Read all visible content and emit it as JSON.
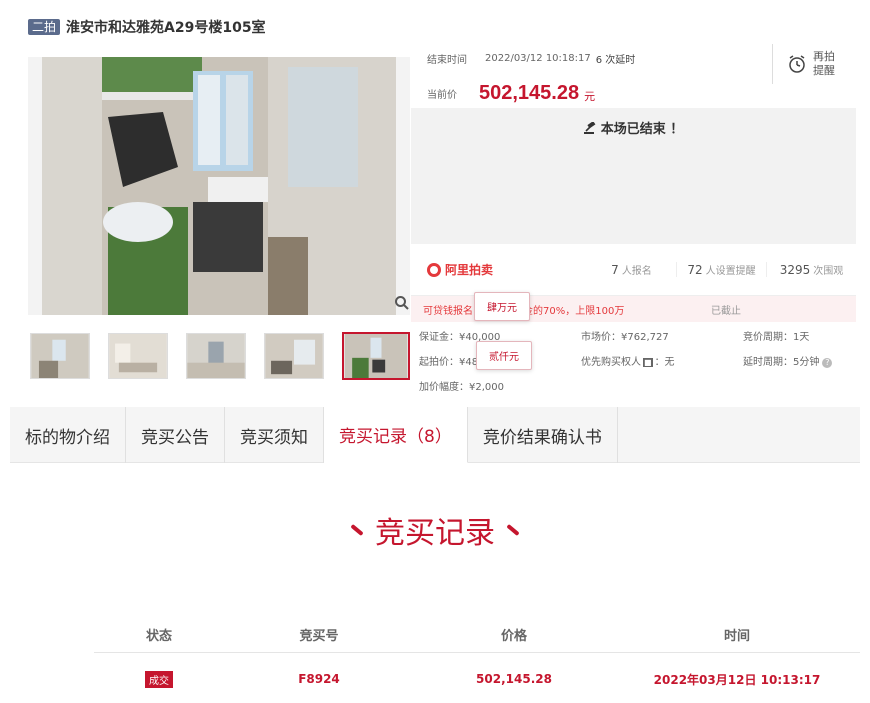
{
  "header": {
    "round_badge": "二拍",
    "lot_title": "淮安市和达雅苑A29号楼105室"
  },
  "auction": {
    "end_label": "结束时间",
    "end_time": "2022/03/12 10:18:17",
    "delay_text": "6 次延时",
    "remind_label": "再拍提醒",
    "price_label": "当前价",
    "current_price": "502,145.28",
    "price_unit": "元",
    "ended_text": "本场已结束 ！"
  },
  "stats": {
    "logo_text": "阿里拍卖",
    "signup_count": "7",
    "signup_label": "人报名",
    "remind_count": "72",
    "remind_label": "人设置提醒",
    "view_count": "3295",
    "view_label": "次围观"
  },
  "loan": {
    "text": "可贷钱报名，最高保证金的70%，上限100万",
    "end": "已截止"
  },
  "details": {
    "deposit": "保证金：¥40,000",
    "market_price": "市场价：¥762,727",
    "bid_cycle": "竞价周期：1天",
    "start_price": "起拍价：¥480,000",
    "priority": "优先购买权人",
    "priority_val": "：无",
    "delay_cycle": "延时周期：5分钟",
    "increment": "加价幅度：¥2,000"
  },
  "tooltips": {
    "tip1": "肆万元",
    "tip2": "贰仟元"
  },
  "tabs": [
    {
      "label": "标的物介绍"
    },
    {
      "label": "竞买公告"
    },
    {
      "label": "竞买须知"
    },
    {
      "label": "竞买记录（8）"
    },
    {
      "label": "竞价结果确认书"
    }
  ],
  "records": {
    "section_title": "竞买记录",
    "headers": {
      "status": "状态",
      "bid_no": "竞买号",
      "price": "价格",
      "time": "时间"
    },
    "rows": [
      {
        "status": "成交",
        "bid_no": "F8924",
        "price": "502,145.28",
        "time": "2022年03月12日 10:13:17"
      }
    ]
  },
  "colors": {
    "accent": "#c5162e",
    "badge": "#5b6b8c"
  }
}
